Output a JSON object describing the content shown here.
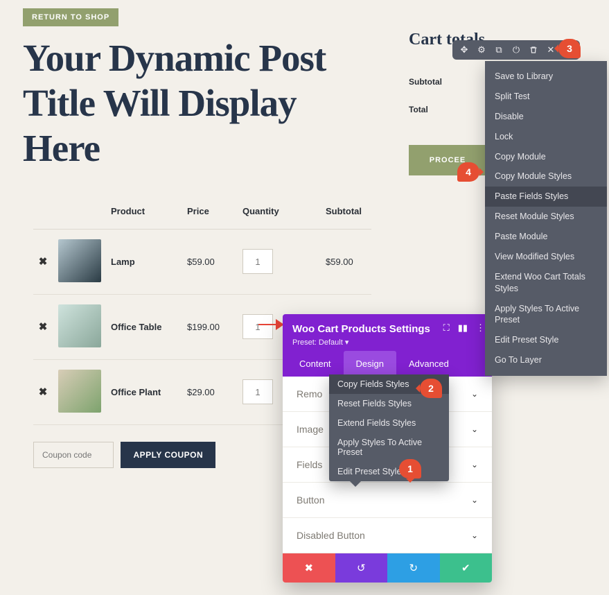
{
  "return_label": "RETURN TO SHOP",
  "page_title": "Your Dynamic Post Title Will Display Here",
  "table": {
    "headers": {
      "product": "Product",
      "price": "Price",
      "quantity": "Quantity",
      "subtotal": "Subtotal"
    },
    "rows": [
      {
        "name": "Lamp",
        "price": "$59.00",
        "qty": "1",
        "subtotal": "$59.00",
        "thumb_colors": [
          "#b5c7cf",
          "#2a3b44"
        ]
      },
      {
        "name": "Office Table",
        "price": "$199.00",
        "qty": "1",
        "subtotal": "",
        "thumb_colors": [
          "#cfe3dd",
          "#8aa79a"
        ]
      },
      {
        "name": "Office Plant",
        "price": "$29.00",
        "qty": "1",
        "subtotal": "",
        "thumb_colors": [
          "#d8cdb7",
          "#7da36d"
        ]
      }
    ]
  },
  "coupon": {
    "placeholder": "Coupon code",
    "apply_label": "APPLY COUPON"
  },
  "totals": {
    "heading": "Cart totals",
    "subtotal_label": "Subtotal",
    "total_label": "Total",
    "proceed_label": "PROCEE"
  },
  "ctx_menu": {
    "items": [
      "Save to Library",
      "Split Test",
      "Disable",
      "Lock",
      "Copy Module",
      "Copy Module Styles",
      "Paste Fields Styles",
      "Reset Module Styles",
      "Paste Module",
      "View Modified Styles",
      "Extend Woo Cart Totals Styles",
      "Apply Styles To Active Preset",
      "Edit Preset Style",
      "Go To Layer"
    ],
    "highlight_index": 6
  },
  "panel": {
    "title": "Woo Cart Products Settings",
    "preset": "Preset: Default",
    "tabs": {
      "content": "Content",
      "design": "Design",
      "advanced": "Advanced"
    },
    "sections": [
      "Remo",
      "Image",
      "Fields",
      "Button",
      "Disabled Button"
    ]
  },
  "field_menu": {
    "items": [
      "Copy Fields Styles",
      "Reset Fields Styles",
      "Extend Fields Styles",
      "Apply Styles To Active Preset",
      "Edit Preset Style"
    ],
    "highlight_index": 0
  },
  "callouts": {
    "c1": "1",
    "c2": "2",
    "c3": "3",
    "c4": "4"
  }
}
